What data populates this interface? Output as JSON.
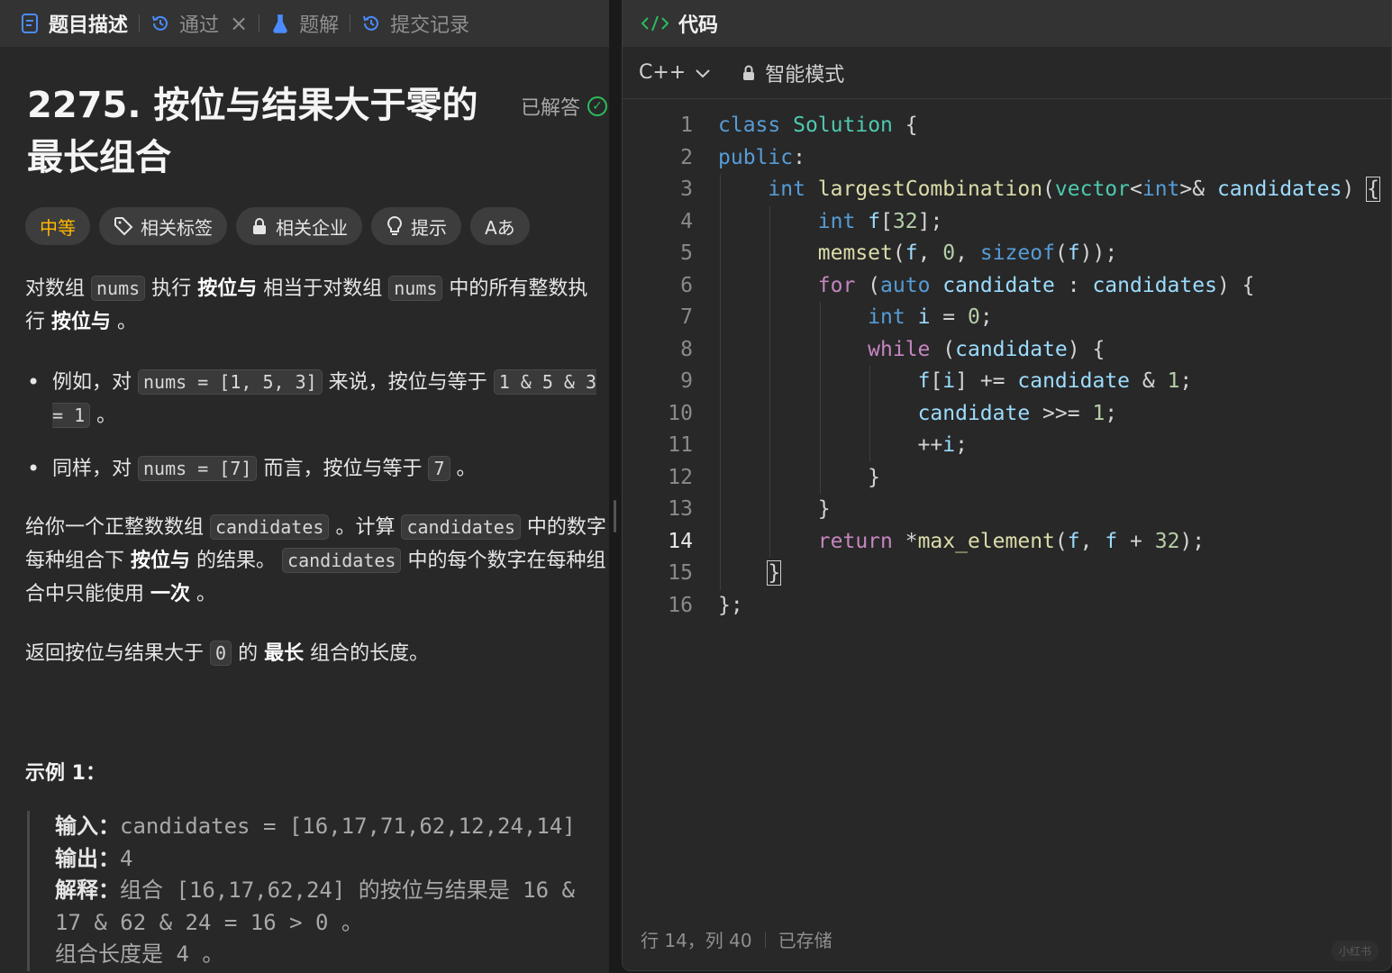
{
  "left_tabs": [
    {
      "label": "题目描述",
      "icon": "document-icon"
    },
    {
      "label": "通过",
      "icon": "history-icon"
    },
    {
      "label": "题解",
      "icon": "flask-icon"
    },
    {
      "label": "提交记录",
      "icon": "history-icon"
    }
  ],
  "problem": {
    "title": "2275. 按位与结果大于零的最长组合",
    "status": "已解答",
    "difficulty": "中等",
    "chips": [
      "相关标签",
      "相关企业",
      "提示",
      "Aあ"
    ],
    "p1": {
      "t1": "对数组",
      "c1": "nums",
      "t2": "执行",
      "b1": "按位与",
      "t3": "相当于对数组",
      "c2": "nums",
      "t4": "中的所有整数执行",
      "b2": "按位与",
      "t5": "。"
    },
    "bullet1": {
      "t1": "例如，对",
      "c1": "nums = [1, 5, 3]",
      "t2": "来说，按位与等于",
      "c2": "1 & 5 & 3 = 1",
      "t3": "。"
    },
    "bullet2": {
      "t1": "同样，对",
      "c1": "nums = [7]",
      "t2": "而言，按位与等于",
      "c2": "7",
      "t3": "。"
    },
    "p2": {
      "t1": "给你一个正整数数组",
      "c1": "candidates",
      "t2": "。计算",
      "c2": "candidates",
      "t3": "中的数字每种组合下",
      "b1": "按位与",
      "t4": "的结果。",
      "c3": "candidates",
      "t5": "中的每个数字在每种组合中只能使用",
      "b2": "一次",
      "t6": "。"
    },
    "p3": {
      "t1": "返回按位与结果大于",
      "c1": "0",
      "t2": "的",
      "b1": "最长",
      "t3": "组合的长度。"
    },
    "example_title": "示例 1：",
    "example": {
      "input_label": "输入：",
      "input": "candidates = [16,17,71,62,12,24,14]",
      "output_label": "输出：",
      "output": "4",
      "explain_label": "解释：",
      "explain1": "组合 [16,17,62,24] 的按位与结果是 16 & 17 & 62 & 24 = 16 > 0 。",
      "explain2": "组合长度是 4 。"
    }
  },
  "editor": {
    "tab_label": "代码",
    "language": "C++",
    "mode": "智能模式",
    "current_line": 14,
    "status_position": "行 14，列 40",
    "status_saved": "已存储",
    "lines": [
      "class Solution {",
      "public:",
      "    int largestCombination(vector<int>& candidates) {",
      "        int f[32];",
      "        memset(f, 0, sizeof(f));",
      "        for (auto candidate : candidates) {",
      "            int i = 0;",
      "            while (candidate) {",
      "                f[i] += candidate & 1;",
      "                candidate >>= 1;",
      "                ++i;",
      "            }",
      "        }",
      "        return *max_element(f, f + 32);",
      "    }",
      "};"
    ]
  },
  "watermark": "小红书"
}
